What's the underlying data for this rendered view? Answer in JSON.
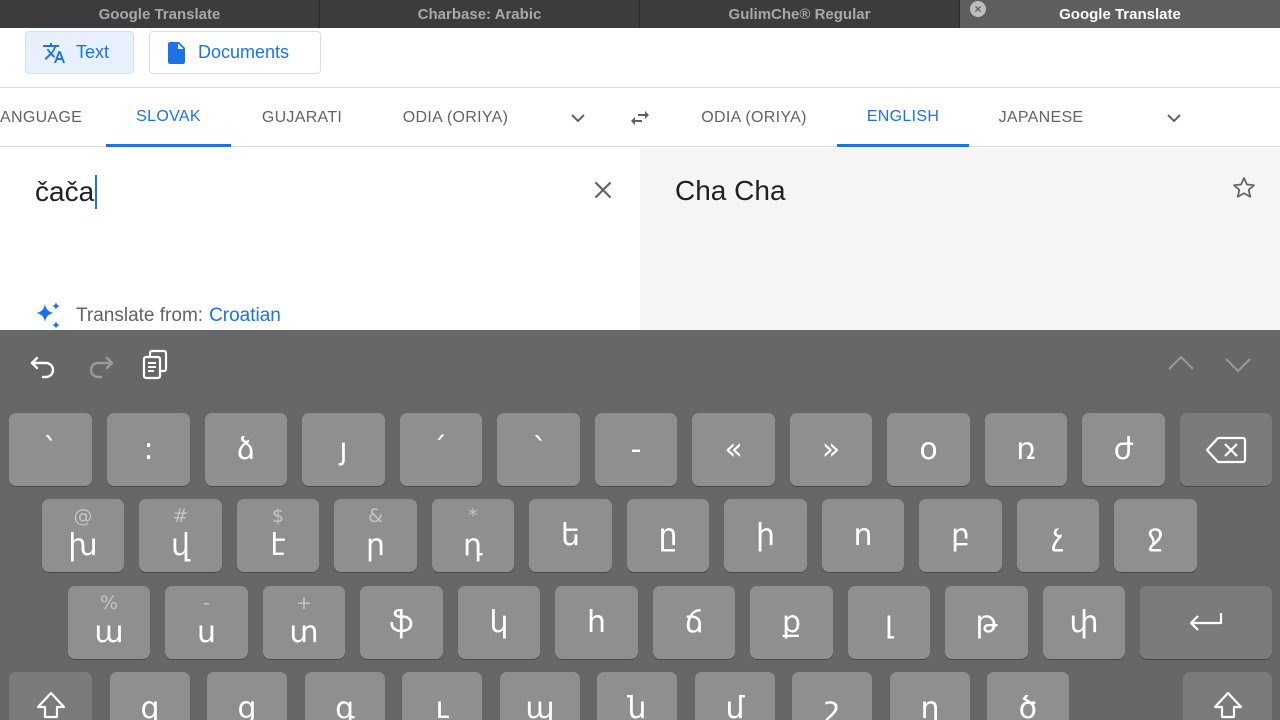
{
  "browser": {
    "tabs": [
      {
        "title": "Google Translate",
        "active": false
      },
      {
        "title": "Charbase: Arabic",
        "active": false
      },
      {
        "title": "GulimChe® Regular",
        "active": false
      },
      {
        "title": "Google Translate",
        "active": true
      }
    ]
  },
  "modes": {
    "text_label": "Text",
    "documents_label": "Documents"
  },
  "source_langs": [
    "ANGUAGE",
    "SLOVAK",
    "GUJARATI",
    "ODIA (ORIYA)"
  ],
  "target_langs": [
    "ODIA (ORIYA)",
    "ENGLISH",
    "JAPANESE"
  ],
  "active_source_lang": "SLOVAK",
  "active_target_lang": "ENGLISH",
  "source": {
    "text": "čača",
    "suggestion_prefix": "Translate from:",
    "suggestion_lang": "Croatian"
  },
  "target": {
    "text": "Cha Cha"
  },
  "keyboard": {
    "row1": [
      "`",
      ":",
      "ձ",
      "յ",
      "՛",
      "՝",
      "-",
      "«",
      "»",
      "o",
      "ռ",
      "ժ"
    ],
    "row2": [
      {
        "pri": "խ",
        "sec": "@"
      },
      {
        "pri": "վ",
        "sec": "#"
      },
      {
        "pri": "է",
        "sec": "$"
      },
      {
        "pri": "ր",
        "sec": "&"
      },
      {
        "pri": "դ",
        "sec": "*"
      },
      {
        "pri": "ե",
        "sec": ""
      },
      {
        "pri": "ը",
        "sec": ""
      },
      {
        "pri": "ի",
        "sec": ""
      },
      {
        "pri": "ո",
        "sec": ""
      },
      {
        "pri": "բ",
        "sec": ""
      },
      {
        "pri": "չ",
        "sec": ""
      },
      {
        "pri": "ջ",
        "sec": ""
      }
    ],
    "row3": [
      {
        "pri": "ա",
        "sec": "%"
      },
      {
        "pri": "ս",
        "sec": "-"
      },
      {
        "pri": "տ",
        "sec": "+"
      },
      {
        "pri": "ֆ",
        "sec": ""
      },
      {
        "pri": "կ",
        "sec": ""
      },
      {
        "pri": "հ",
        "sec": ""
      },
      {
        "pri": "ճ",
        "sec": ""
      },
      {
        "pri": "ք",
        "sec": ""
      },
      {
        "pri": "լ",
        "sec": ""
      },
      {
        "pri": "թ",
        "sec": ""
      },
      {
        "pri": "փ",
        "sec": ""
      }
    ],
    "row4": [
      "զ",
      "ց",
      "գ",
      "ւ",
      "պ",
      "ն",
      "մ",
      "շ",
      "ղ",
      "ծ"
    ]
  },
  "colors": {
    "accent": "#1a73e8",
    "keyboard_bg": "#666769",
    "key_bg": "#8f8f91"
  },
  "icons": {
    "text_mode": "translate-icon",
    "documents_mode": "document-icon",
    "dropdown": "chevron-down-icon",
    "swap": "swap-arrows-icon",
    "clear": "close-icon",
    "save": "star-icon",
    "suggestion": "sparkle-icon",
    "undo": "undo-icon",
    "redo": "redo-icon",
    "paste": "clipboard-icon",
    "backspace": "backspace-icon",
    "return": "return-icon",
    "shift": "shift-icon"
  }
}
